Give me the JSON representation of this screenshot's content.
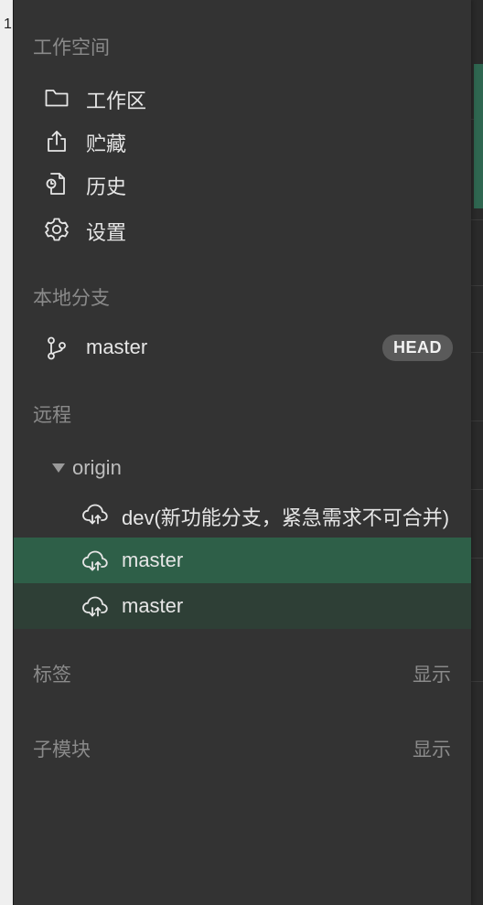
{
  "background": {
    "char": "1"
  },
  "sidebar": {
    "workspace_section": {
      "title": "工作空间",
      "items": [
        {
          "label": "工作区",
          "icon": "folder-icon"
        },
        {
          "label": "贮藏",
          "icon": "stash-icon"
        },
        {
          "label": "历史",
          "icon": "history-icon"
        },
        {
          "label": "设置",
          "icon": "gear-icon"
        }
      ]
    },
    "local_branches": {
      "title": "本地分支",
      "items": [
        {
          "label": "master",
          "badge": "HEAD",
          "icon": "branch-icon"
        }
      ]
    },
    "remotes": {
      "title": "远程",
      "remote_name": "origin",
      "branches": [
        {
          "label": "dev(新功能分支，紧急需求不可合并)",
          "state": "normal",
          "icon": "cloud-sync-icon"
        },
        {
          "label": "master",
          "state": "selected",
          "icon": "cloud-sync-icon"
        },
        {
          "label": "master",
          "state": "hover",
          "icon": "cloud-sync-icon"
        }
      ]
    },
    "tags": {
      "title": "标签",
      "action": "显示"
    },
    "submodules": {
      "title": "子模块",
      "action": "显示"
    }
  },
  "colors": {
    "panel_bg": "#333333",
    "selected_row": "#2e5f48",
    "hover_row": "#2e3f36",
    "muted_text": "#8a8a8a",
    "text": "#e6e6e6",
    "badge_bg": "#5a5a5a",
    "scroll_accent": "#2f6650"
  }
}
